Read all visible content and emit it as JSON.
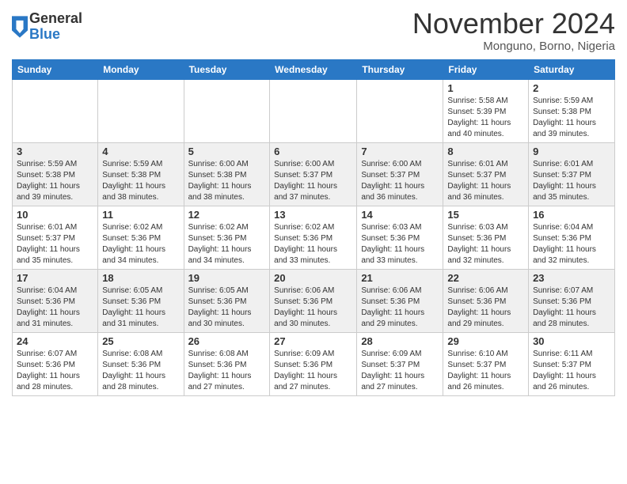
{
  "logo": {
    "general": "General",
    "blue": "Blue"
  },
  "title": "November 2024",
  "location": "Monguno, Borno, Nigeria",
  "weekdays": [
    "Sunday",
    "Monday",
    "Tuesday",
    "Wednesday",
    "Thursday",
    "Friday",
    "Saturday"
  ],
  "weeks": [
    [
      {
        "day": "",
        "info": ""
      },
      {
        "day": "",
        "info": ""
      },
      {
        "day": "",
        "info": ""
      },
      {
        "day": "",
        "info": ""
      },
      {
        "day": "",
        "info": ""
      },
      {
        "day": "1",
        "info": "Sunrise: 5:58 AM\nSunset: 5:39 PM\nDaylight: 11 hours\nand 40 minutes."
      },
      {
        "day": "2",
        "info": "Sunrise: 5:59 AM\nSunset: 5:38 PM\nDaylight: 11 hours\nand 39 minutes."
      }
    ],
    [
      {
        "day": "3",
        "info": "Sunrise: 5:59 AM\nSunset: 5:38 PM\nDaylight: 11 hours\nand 39 minutes."
      },
      {
        "day": "4",
        "info": "Sunrise: 5:59 AM\nSunset: 5:38 PM\nDaylight: 11 hours\nand 38 minutes."
      },
      {
        "day": "5",
        "info": "Sunrise: 6:00 AM\nSunset: 5:38 PM\nDaylight: 11 hours\nand 38 minutes."
      },
      {
        "day": "6",
        "info": "Sunrise: 6:00 AM\nSunset: 5:37 PM\nDaylight: 11 hours\nand 37 minutes."
      },
      {
        "day": "7",
        "info": "Sunrise: 6:00 AM\nSunset: 5:37 PM\nDaylight: 11 hours\nand 36 minutes."
      },
      {
        "day": "8",
        "info": "Sunrise: 6:01 AM\nSunset: 5:37 PM\nDaylight: 11 hours\nand 36 minutes."
      },
      {
        "day": "9",
        "info": "Sunrise: 6:01 AM\nSunset: 5:37 PM\nDaylight: 11 hours\nand 35 minutes."
      }
    ],
    [
      {
        "day": "10",
        "info": "Sunrise: 6:01 AM\nSunset: 5:37 PM\nDaylight: 11 hours\nand 35 minutes."
      },
      {
        "day": "11",
        "info": "Sunrise: 6:02 AM\nSunset: 5:36 PM\nDaylight: 11 hours\nand 34 minutes."
      },
      {
        "day": "12",
        "info": "Sunrise: 6:02 AM\nSunset: 5:36 PM\nDaylight: 11 hours\nand 34 minutes."
      },
      {
        "day": "13",
        "info": "Sunrise: 6:02 AM\nSunset: 5:36 PM\nDaylight: 11 hours\nand 33 minutes."
      },
      {
        "day": "14",
        "info": "Sunrise: 6:03 AM\nSunset: 5:36 PM\nDaylight: 11 hours\nand 33 minutes."
      },
      {
        "day": "15",
        "info": "Sunrise: 6:03 AM\nSunset: 5:36 PM\nDaylight: 11 hours\nand 32 minutes."
      },
      {
        "day": "16",
        "info": "Sunrise: 6:04 AM\nSunset: 5:36 PM\nDaylight: 11 hours\nand 32 minutes."
      }
    ],
    [
      {
        "day": "17",
        "info": "Sunrise: 6:04 AM\nSunset: 5:36 PM\nDaylight: 11 hours\nand 31 minutes."
      },
      {
        "day": "18",
        "info": "Sunrise: 6:05 AM\nSunset: 5:36 PM\nDaylight: 11 hours\nand 31 minutes."
      },
      {
        "day": "19",
        "info": "Sunrise: 6:05 AM\nSunset: 5:36 PM\nDaylight: 11 hours\nand 30 minutes."
      },
      {
        "day": "20",
        "info": "Sunrise: 6:06 AM\nSunset: 5:36 PM\nDaylight: 11 hours\nand 30 minutes."
      },
      {
        "day": "21",
        "info": "Sunrise: 6:06 AM\nSunset: 5:36 PM\nDaylight: 11 hours\nand 29 minutes."
      },
      {
        "day": "22",
        "info": "Sunrise: 6:06 AM\nSunset: 5:36 PM\nDaylight: 11 hours\nand 29 minutes."
      },
      {
        "day": "23",
        "info": "Sunrise: 6:07 AM\nSunset: 5:36 PM\nDaylight: 11 hours\nand 28 minutes."
      }
    ],
    [
      {
        "day": "24",
        "info": "Sunrise: 6:07 AM\nSunset: 5:36 PM\nDaylight: 11 hours\nand 28 minutes."
      },
      {
        "day": "25",
        "info": "Sunrise: 6:08 AM\nSunset: 5:36 PM\nDaylight: 11 hours\nand 28 minutes."
      },
      {
        "day": "26",
        "info": "Sunrise: 6:08 AM\nSunset: 5:36 PM\nDaylight: 11 hours\nand 27 minutes."
      },
      {
        "day": "27",
        "info": "Sunrise: 6:09 AM\nSunset: 5:36 PM\nDaylight: 11 hours\nand 27 minutes."
      },
      {
        "day": "28",
        "info": "Sunrise: 6:09 AM\nSunset: 5:37 PM\nDaylight: 11 hours\nand 27 minutes."
      },
      {
        "day": "29",
        "info": "Sunrise: 6:10 AM\nSunset: 5:37 PM\nDaylight: 11 hours\nand 26 minutes."
      },
      {
        "day": "30",
        "info": "Sunrise: 6:11 AM\nSunset: 5:37 PM\nDaylight: 11 hours\nand 26 minutes."
      }
    ]
  ]
}
